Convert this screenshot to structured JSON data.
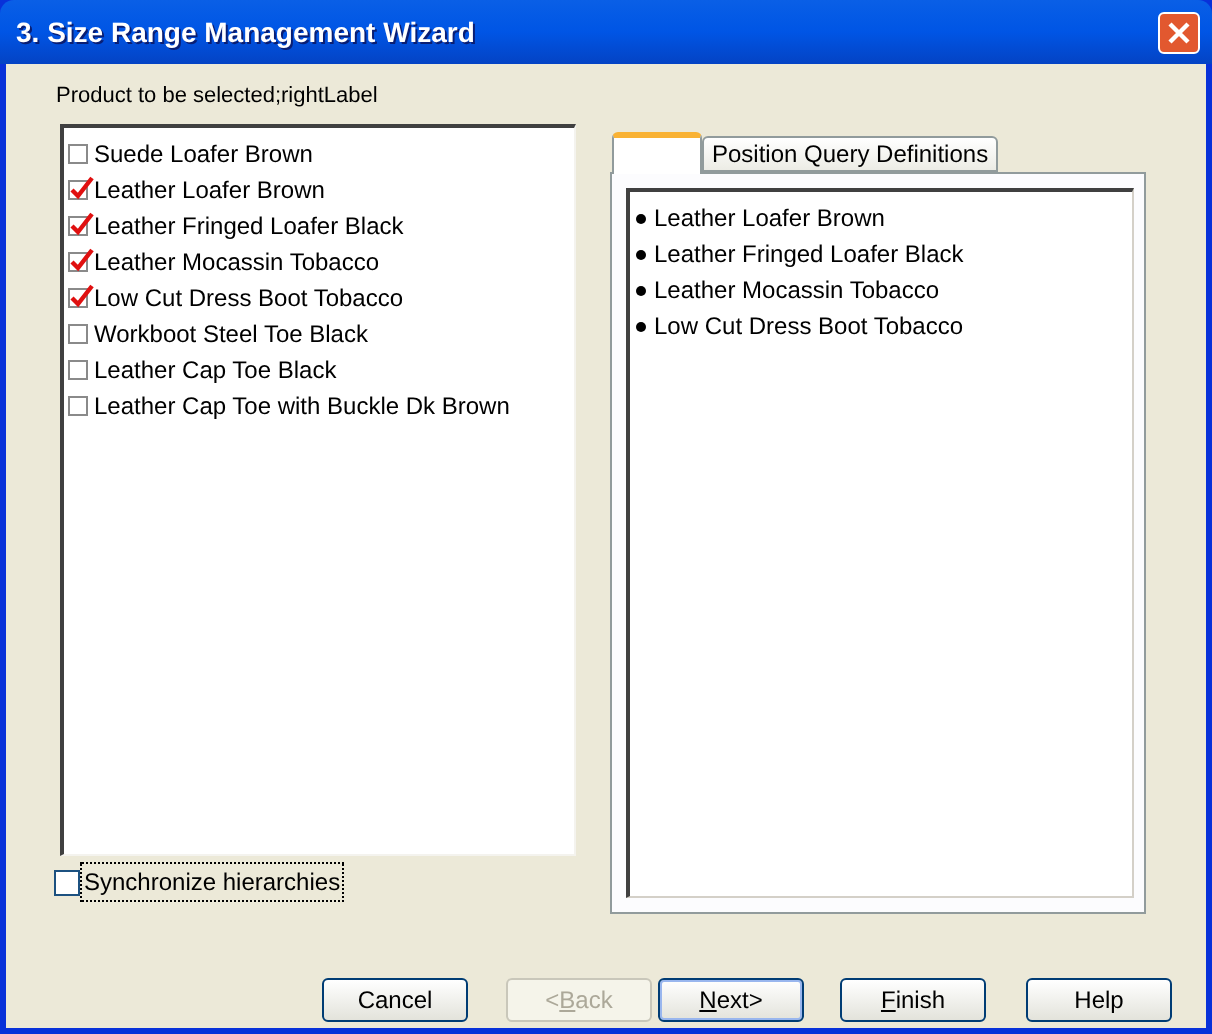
{
  "window": {
    "title": "3. Size Range Management Wizard"
  },
  "left": {
    "label": "Product to be selected;rightLabel",
    "items": [
      {
        "label": "Suede Loafer Brown",
        "checked": false
      },
      {
        "label": "Leather Loafer Brown",
        "checked": true
      },
      {
        "label": "Leather Fringed Loafer Black",
        "checked": true
      },
      {
        "label": "Leather Mocassin Tobacco",
        "checked": true
      },
      {
        "label": "Low Cut Dress Boot Tobacco",
        "checked": true
      },
      {
        "label": "Workboot Steel Toe Black",
        "checked": false
      },
      {
        "label": "Leather Cap Toe Black",
        "checked": false
      },
      {
        "label": "Leather Cap Toe with Buckle Dk Brown",
        "checked": false
      }
    ]
  },
  "sync": {
    "label": "Synchronize hierarchies",
    "checked": false
  },
  "tabs": [
    {
      "selected": true
    },
    {
      "label": "Position Query Definitions",
      "selected": false
    }
  ],
  "right_items": [
    "Leather Loafer Brown",
    "Leather Fringed Loafer Black",
    "Leather Mocassin Tobacco",
    "Low Cut Dress Boot Tobacco"
  ],
  "buttons": [
    {
      "parts": [
        {
          "text": "Cancel",
          "underline": false
        }
      ],
      "disabled": false,
      "default": false
    },
    {
      "parts": [
        {
          "text": "<",
          "underline": false
        },
        {
          "text": "B",
          "underline": true
        },
        {
          "text": "ack",
          "underline": false
        }
      ],
      "disabled": true,
      "default": false
    },
    {
      "parts": [
        {
          "text": "N",
          "underline": true
        },
        {
          "text": "ext>",
          "underline": false
        }
      ],
      "disabled": false,
      "default": true
    },
    {
      "parts": [
        {
          "text": "F",
          "underline": true
        },
        {
          "text": "inish",
          "underline": false
        }
      ],
      "disabled": false,
      "default": false
    },
    {
      "parts": [
        {
          "text": "Help",
          "underline": false
        }
      ],
      "disabled": false,
      "default": false
    }
  ]
}
